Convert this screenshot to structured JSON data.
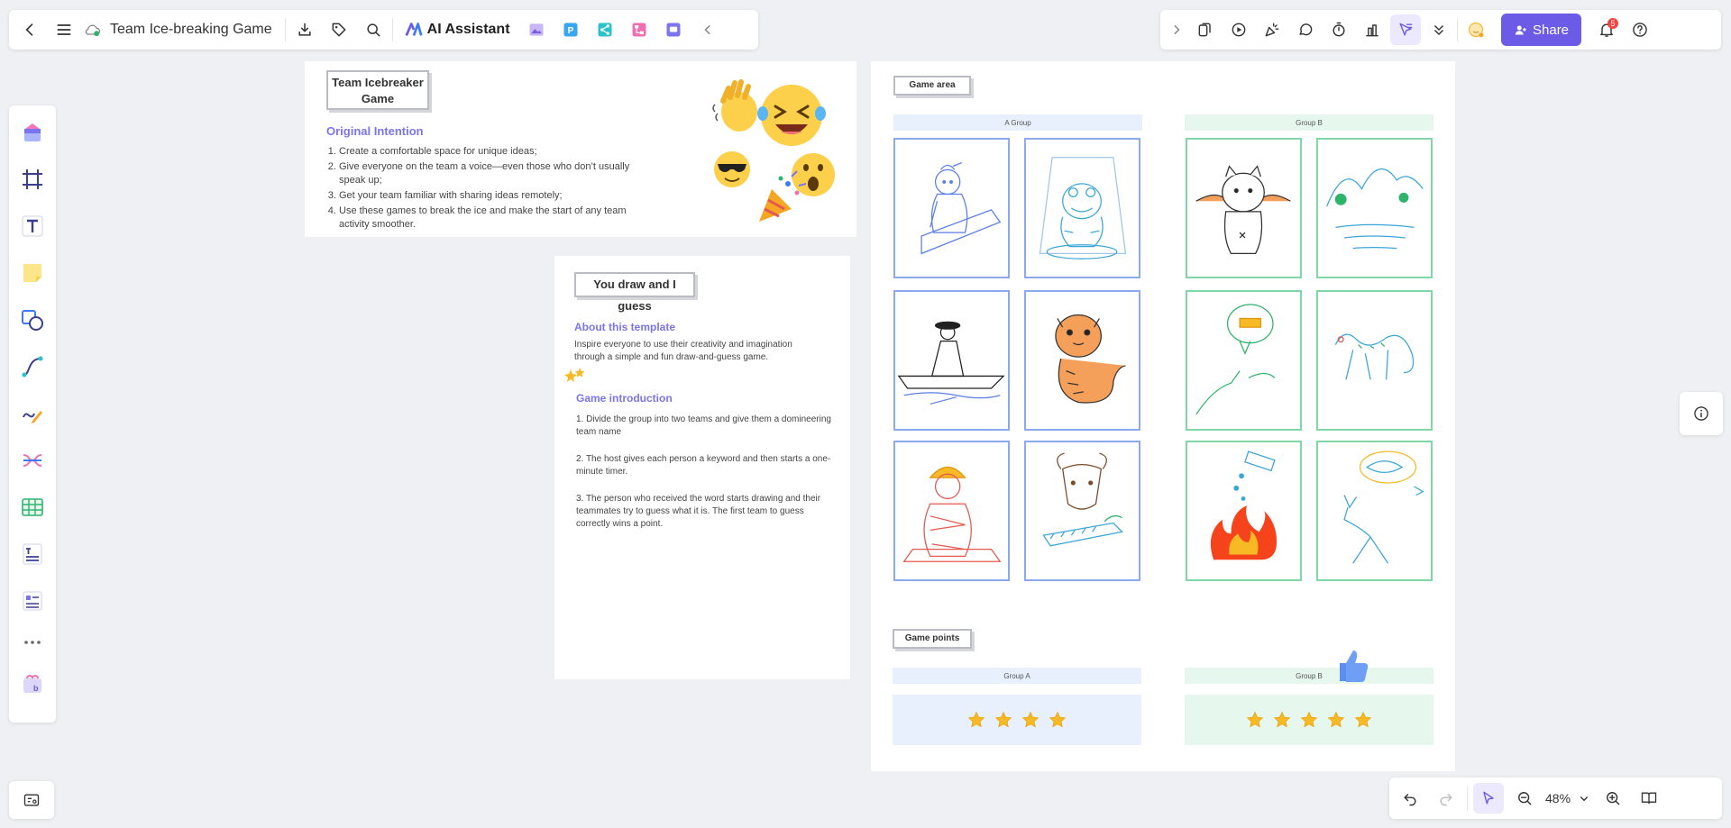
{
  "topbar": {
    "title": "Team Ice-breaking Game",
    "ai_label": "AI Assistant"
  },
  "share": {
    "label": "Share"
  },
  "notifications": {
    "count": "5"
  },
  "zoom": {
    "value": "48%"
  },
  "intro_board": {
    "title": "Team Icebreaker Game",
    "heading": "Original Intention",
    "items": [
      "Create a comfortable space for unique ideas;",
      "Give everyone on the team a voice—even those who don’t usually speak up;",
      "Get your team familiar with sharing ideas remotely;",
      "Use these games to break the ice and make the start of any team activity smoother."
    ]
  },
  "guess_board": {
    "title": "You draw and I guess",
    "about_heading": "About this template",
    "about_text": "Inspire everyone to use their creativity and imagination through a simple and fun draw-and-guess game.",
    "intro_heading": "Game introduction",
    "steps": [
      "1. Divide the group into two teams and give them a domineering team name",
      "2. The host gives each person a keyword and then starts a one-minute timer.",
      "3. The person who received the word starts drawing and their teammates try to guess what it is. The first team to guess correctly wins a point."
    ]
  },
  "game_board": {
    "area_label": "Game area",
    "group_a_label": "A Group",
    "group_b_label": "Group B",
    "points_label": "Game points",
    "points_group_a": "Group A",
    "points_group_b": "Group B"
  },
  "colors": {
    "accent": "#6b5be6",
    "group_a_bg": "#e8f0fd",
    "group_b_bg": "#e6f7ee",
    "blue_border": "#8aa9f0",
    "green_border": "#7fd8a6",
    "star": "#f7b924",
    "heading_purple": "#7b74f0"
  },
  "scores": {
    "group_a": 4,
    "group_b": 5
  }
}
